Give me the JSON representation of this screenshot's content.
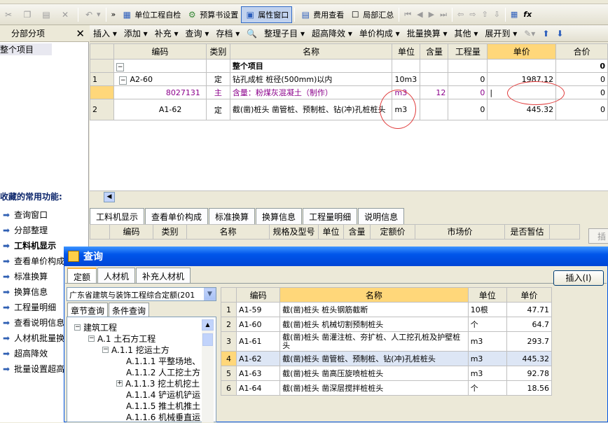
{
  "toolbar1": {
    "check_label": "单位工程自检",
    "budget_settings_label": "预算书设置",
    "property_window_label": "属性窗口",
    "cost_view_label": "费用查看",
    "partial_summary_label": "局部汇总"
  },
  "left_panel": {
    "title": "分部分项",
    "tree_root": "整个项目",
    "favorites_title": "收藏的常用功能:",
    "favorites": [
      "查询窗口",
      "分部整理",
      "工料机显示",
      "查看单价构成",
      "标准换算",
      "换算信息",
      "工程量明细",
      "查看说明信息",
      "人材机批量换",
      "超高降效",
      "批量设置超高"
    ]
  },
  "toolbar2": {
    "items": [
      "插入 ▾",
      "添加 ▾",
      "补充 ▾",
      "查询 ▾",
      "存档 ▾",
      "整理子目 ▾",
      "超高降效 ▾",
      "单价构成 ▾",
      "批量换算 ▾",
      "其他 ▾",
      "展开到 ▾"
    ]
  },
  "main_grid": {
    "headers": [
      "编码",
      "类别",
      "名称",
      "单位",
      "含量",
      "工程量",
      "单价",
      "合价"
    ],
    "rows": [
      {
        "no": "",
        "code": "",
        "type": "",
        "name": "整个项目",
        "unit": "",
        "content": "",
        "qty": "",
        "price": "",
        "total": "0"
      },
      {
        "no": "1",
        "code": "A2-60",
        "type": "定",
        "name": "钻孔成桩 桩径(500mm)以内",
        "unit": "10m3",
        "content": "",
        "qty": "0",
        "price": "1987.12",
        "total": "0"
      },
      {
        "no": "",
        "code": "8027131",
        "type": "主",
        "name": "含量：粉煤灰混凝土（制作）",
        "unit": "m3",
        "content": "12",
        "qty": "0",
        "price": "",
        "total": "0"
      },
      {
        "no": "2",
        "code": "A1-62",
        "type": "定",
        "name": "截(凿)桩头 凿管桩、预制桩、钻(冲)孔桩桩头",
        "unit": "m3",
        "content": "",
        "qty": "0",
        "price": "445.32",
        "total": "0"
      }
    ]
  },
  "bottom_tabs": [
    "工料机显示",
    "查看单价构成",
    "标准换算",
    "换算信息",
    "工程量明细",
    "说明信息"
  ],
  "bottom_grid_headers": [
    "编码",
    "类别",
    "名称",
    "规格及型号",
    "单位",
    "含量",
    "定额价",
    "市场价",
    "是否暂估"
  ],
  "bottom_insert_label": "插入",
  "dialog": {
    "title": "查询",
    "tabs": [
      "定额",
      "人材机",
      "补充人材机"
    ],
    "insert_label": "插入(I)",
    "quota_select": "广东省建筑与装饰工程综合定额(201",
    "sub_tabs": [
      "章节查询",
      "条件查询"
    ],
    "tree": [
      "建筑工程",
      "A.1 土石方工程",
      "A.1.1 挖运土方",
      "A.1.1.1 平整场地、",
      "A.1.1.2 人工挖土方",
      "A.1.1.3 挖土机挖土",
      "A.1.1.4 铲运机铲运",
      "A.1.1.5 推土机推土",
      "A.1.1.6 机械垂直运"
    ],
    "headers": [
      "编码",
      "名称",
      "单位",
      "单价"
    ],
    "rows": [
      {
        "no": "1",
        "code": "A1-59",
        "name": "截(凿)桩头 桩头钢筋截断",
        "unit": "10根",
        "price": "47.71"
      },
      {
        "no": "2",
        "code": "A1-60",
        "name": "截(凿)桩头 机械切割预制桩头",
        "unit": "个",
        "price": "64.7"
      },
      {
        "no": "3",
        "code": "A1-61",
        "name": "截(凿)桩头 凿灌注桩、夯扩桩、人工挖孔桩及护壁桩头",
        "unit": "m3",
        "price": "293.7"
      },
      {
        "no": "4",
        "code": "A1-62",
        "name": "截(凿)桩头 凿管桩、预制桩、钻(冲)孔桩桩头",
        "unit": "m3",
        "price": "445.32"
      },
      {
        "no": "5",
        "code": "A1-63",
        "name": "截(凿)桩头 凿高压旋喷桩桩头",
        "unit": "m3",
        "price": "92.78"
      },
      {
        "no": "6",
        "code": "A1-64",
        "name": "截(凿)桩头 凿深层搅拌桩桩头",
        "unit": "个",
        "price": "18.56"
      }
    ]
  }
}
